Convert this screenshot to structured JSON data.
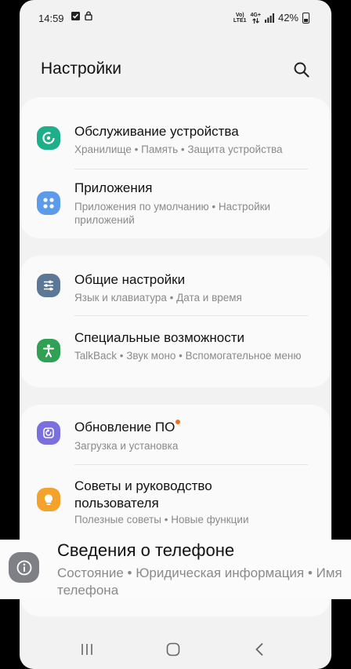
{
  "status_bar": {
    "time": "14:59",
    "network_top": "Vo)",
    "network_sub": "LTE1",
    "network_type": "4G+",
    "battery_text": "42%"
  },
  "header": {
    "title": "Настройки",
    "search_icon": "search-icon"
  },
  "items": [
    {
      "title": "Обслуживание устройства",
      "subtitle": "Хранилище  •  Память  •  Защита устройства",
      "icon": "device-care-icon",
      "color": "#1fae8a"
    },
    {
      "title": "Приложения",
      "subtitle": "Приложения по умолчанию  •  Настройки приложений",
      "icon": "apps-icon",
      "color": "#5b9bea"
    },
    {
      "title": "Общие настройки",
      "subtitle": "Язык и клавиатура  •  Дата и время",
      "icon": "sliders-icon",
      "color": "#5d7897"
    },
    {
      "title": "Специальные возможности",
      "subtitle": "TalkBack  •  Звук моно  •  Вспомогательное меню",
      "icon": "accessibility-icon",
      "color": "#2fa054"
    },
    {
      "title": "Обновление ПО",
      "subtitle": "Загрузка и установка",
      "icon": "software-update-icon",
      "color": "#7b6fe0"
    },
    {
      "title": "Советы и руководство пользователя",
      "subtitle": "Полезные советы  •  Новые функции",
      "icon": "tips-icon",
      "color": "#f3a22c"
    }
  ],
  "highlight": {
    "title": "Сведения о телефоне",
    "subtitle": "Состояние  •  Юридическая информация  •  Имя телефона",
    "icon": "info-icon",
    "color": "#7f8086"
  },
  "navbar": {
    "recents": "recents-icon",
    "home": "home-icon",
    "back": "back-icon"
  }
}
